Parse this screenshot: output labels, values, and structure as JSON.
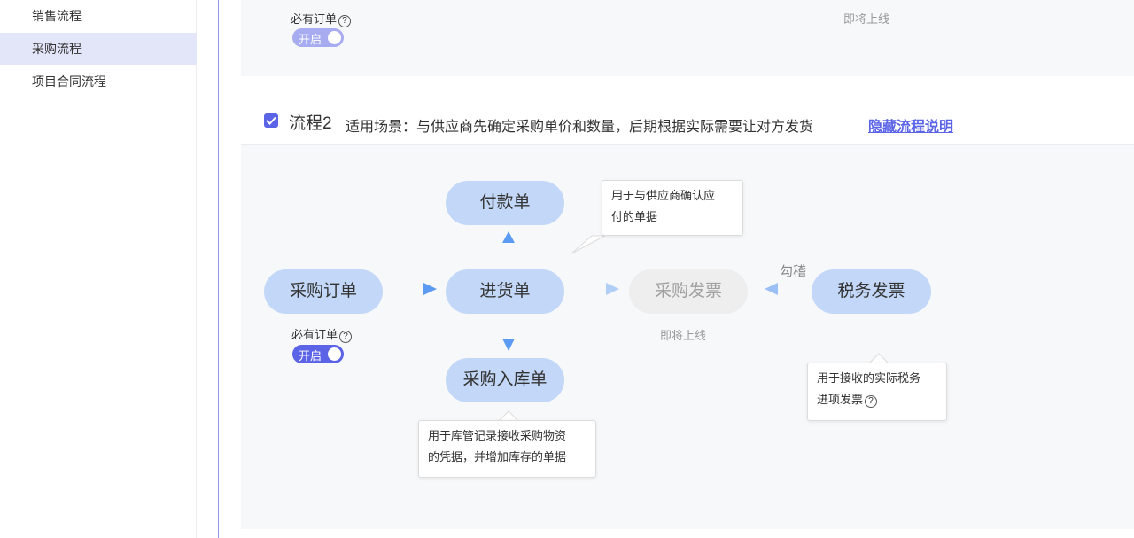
{
  "sidebar": {
    "items": [
      {
        "label": "销售流程"
      },
      {
        "label": "采购流程"
      },
      {
        "label": "项目合同流程"
      }
    ]
  },
  "top_card": {
    "required_label": "必有订单",
    "help_glyph": "?",
    "toggle_label": "开启",
    "coming_soon": "即将上线"
  },
  "flow2": {
    "title": "流程2",
    "desc": "适用场景：与供应商先确定采购单价和数量，后期根据实际需要让对方发货",
    "hide_link": "隐藏流程说明",
    "nodes": {
      "purchase_order": "采购订单",
      "payment": "付款单",
      "goods_receipt": "进货单",
      "purchase_invoice": "采购发票",
      "tax_invoice": "税务发票",
      "warehouse_in": "采购入库单"
    },
    "required_label": "必有订单",
    "toggle_label": "开启",
    "coming_soon": "即将上线",
    "match_label": "勾稽",
    "tips": {
      "payment": [
        "用于与供应商确认应",
        "付的单据"
      ],
      "warehouse": [
        "用于库管记录接收采购物资",
        "的凭据，并增加库存的单据"
      ],
      "tax": [
        "用于接收的实际税务",
        "进项发票"
      ]
    }
  },
  "colors": {
    "accent": "#5b63e6",
    "node": "#c3d8f8",
    "node_disabled": "#eeeeee",
    "arrow": "#5b9bf3",
    "sidebar_active": "#e3e5f9"
  }
}
